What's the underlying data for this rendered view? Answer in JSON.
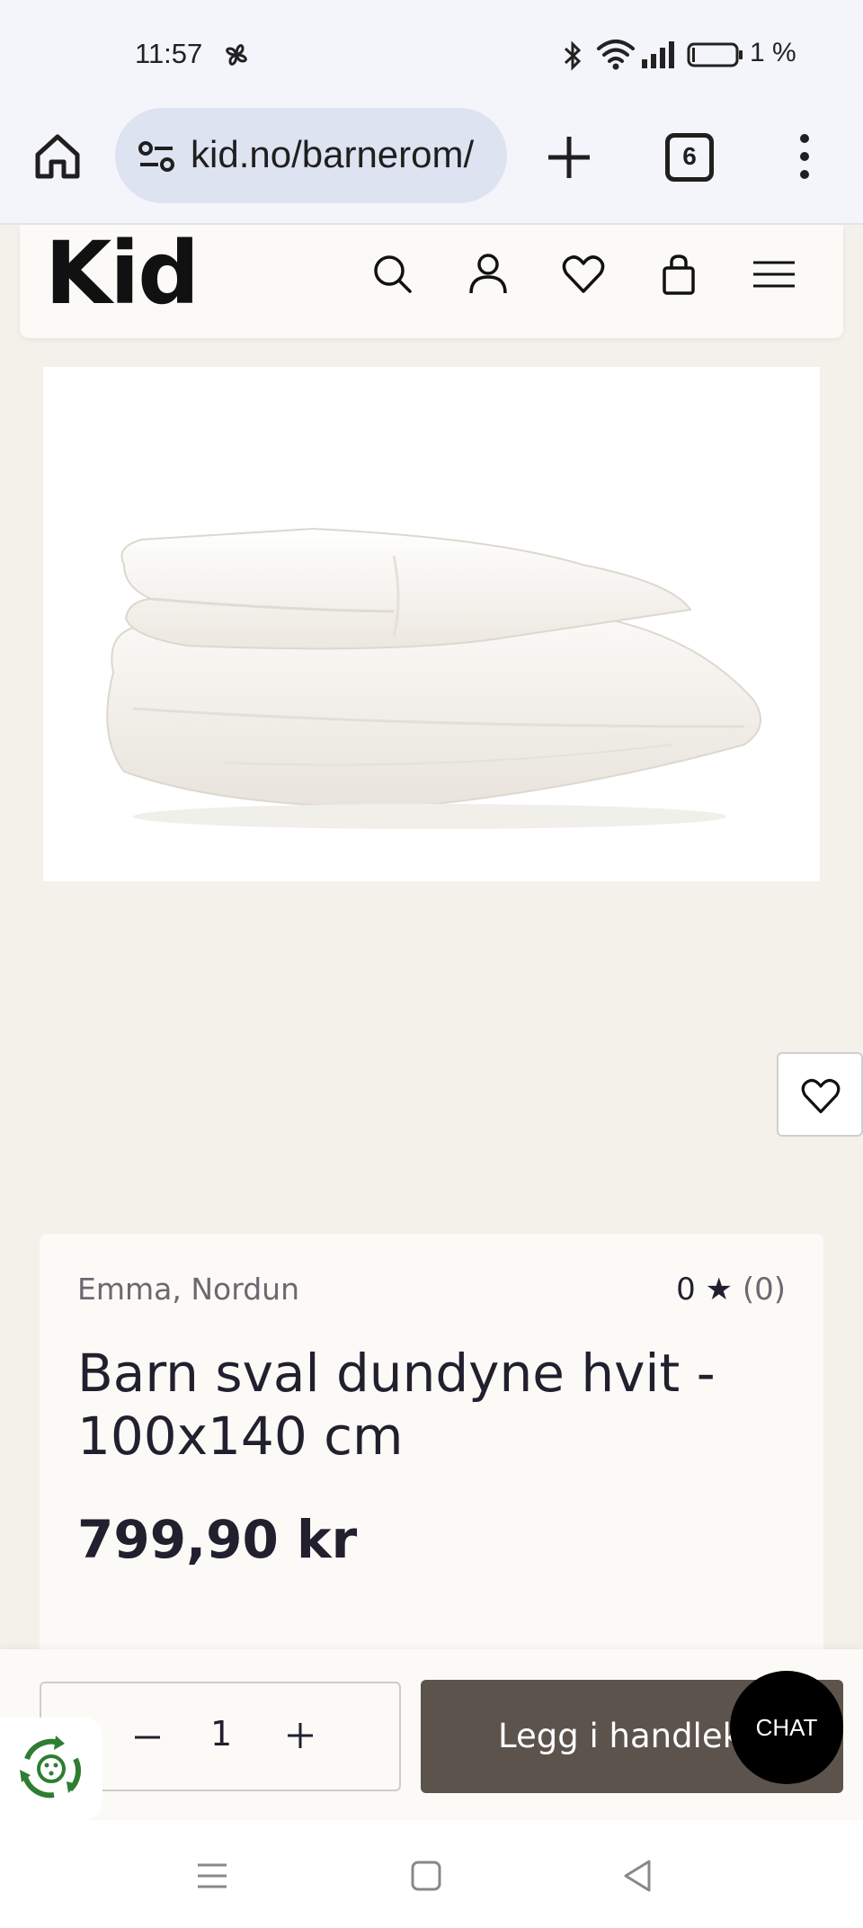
{
  "status_bar": {
    "time": "11:57",
    "battery_percent": "1 %",
    "icons": [
      "fan-icon",
      "bluetooth-icon",
      "wifi-icon",
      "signal-icon",
      "battery-icon"
    ]
  },
  "browser": {
    "url": "kid.no/barnerom/",
    "tab_count": "6"
  },
  "site": {
    "logo": "Kid",
    "header_icons": [
      "search-icon",
      "account-icon",
      "wishlist-icon",
      "cart-icon",
      "menu-icon"
    ]
  },
  "product": {
    "brand": "Emma, Nordun",
    "rating_value": "0 ★",
    "rating_count": "(0)",
    "title": "Barn sval dundyne hvit - 100x140 cm",
    "price": "799,90 kr"
  },
  "cart": {
    "quantity": "1",
    "add_label": "Legg i handlekurv",
    "chat_label": "CHAT"
  },
  "colors": {
    "page_bg": "#f3f1ea",
    "card_bg": "#fbfaf6",
    "add_button": "#5d534d",
    "text": "#221f2e",
    "recycle_green": "#2e7d32"
  }
}
